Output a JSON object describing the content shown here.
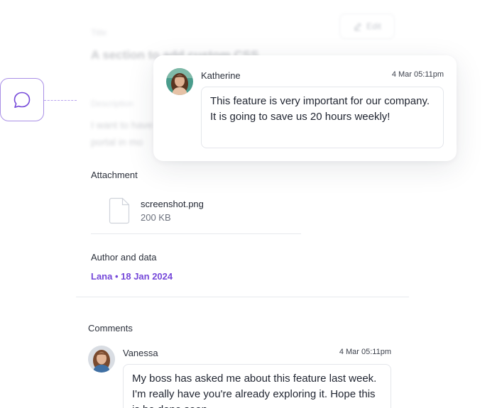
{
  "background_form": {
    "title_label": "Title",
    "title_value": "A section to add custom CSS",
    "description_label": "Description",
    "description_lines": [
      "I want to have",
      "portal in mo"
    ],
    "edit_label": "Edit"
  },
  "floating_comment": {
    "author": "Katherine",
    "time": "4 Mar 05:11pm",
    "text": "This feature is very important for our company. It is going to save us 20 hours weekly!"
  },
  "attachment": {
    "label": "Attachment",
    "file_name": "screenshot.png",
    "file_size": "200 KB"
  },
  "author_section": {
    "label": "Author and data",
    "value": "Lana • 18 Jan 2024"
  },
  "comments": {
    "label": "Comments",
    "items": [
      {
        "author": "Vanessa",
        "time": "4 Mar 05:11pm",
        "text": "My boss has asked me about this feature last week. I'm really have you're already exploring it. Hope this is be done soon."
      }
    ]
  },
  "colors": {
    "accent": "#7548d9",
    "accent_light": "#a98fe6",
    "border": "#e4e6eb"
  },
  "icons": {
    "comment_trigger": "speech-bubble-icon",
    "file": "file-icon",
    "edit": "pencil-icon"
  }
}
